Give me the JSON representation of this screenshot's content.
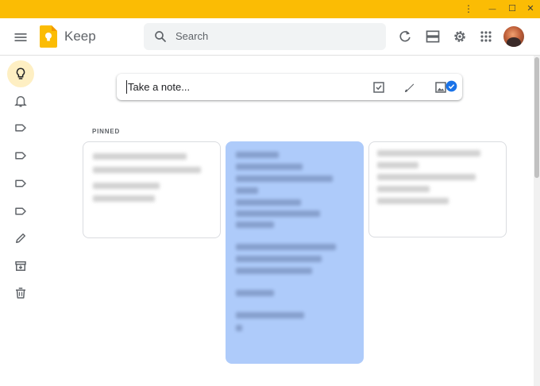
{
  "window": {
    "controls": {
      "menu_glyph": "⋮",
      "minimize_glyph": "—",
      "maximize_glyph": "☐",
      "close_glyph": "✕"
    }
  },
  "header": {
    "app_name": "Keep",
    "search_placeholder": "Search",
    "icons": [
      "menu-icon",
      "keep-logo-icon",
      "search-icon",
      "refresh-icon",
      "list-view-icon",
      "settings-icon",
      "apps-grid-icon",
      "avatar"
    ]
  },
  "sidebar": {
    "items": [
      {
        "name": "notes",
        "icon": "lightbulb-icon",
        "active": true
      },
      {
        "name": "reminders",
        "icon": "bell-icon",
        "active": false
      },
      {
        "name": "label-1",
        "icon": "label-icon",
        "active": false
      },
      {
        "name": "label-2",
        "icon": "label-icon",
        "active": false
      },
      {
        "name": "label-3",
        "icon": "label-icon",
        "active": false
      },
      {
        "name": "label-4",
        "icon": "label-icon",
        "active": false
      },
      {
        "name": "edit-labels",
        "icon": "pencil-icon",
        "active": false
      },
      {
        "name": "archive",
        "icon": "archive-icon",
        "active": false
      },
      {
        "name": "trash",
        "icon": "trash-icon",
        "active": false
      }
    ]
  },
  "take_note": {
    "placeholder": "Take a note...",
    "icons": [
      "checkbox-icon",
      "brush-icon",
      "image-icon"
    ]
  },
  "pinned": {
    "label": "PINNED",
    "notes": [
      {
        "content": "blurred",
        "selected": false
      },
      {
        "content": "blurred",
        "selected": true
      },
      {
        "content": "blurred",
        "selected": false
      }
    ]
  },
  "colors": {
    "titlebar": "#fbbc04",
    "active_nav": "#feefc3",
    "selected_note": "#aecbfa",
    "accent_blue": "#1a73e8"
  }
}
